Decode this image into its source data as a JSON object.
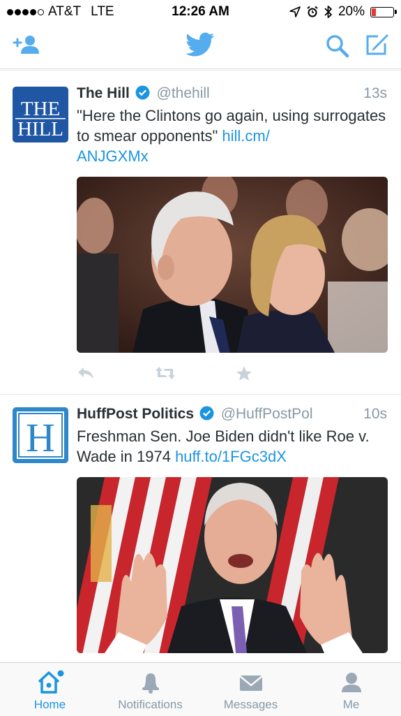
{
  "status_bar": {
    "carrier": "AT&T",
    "network": "LTE",
    "time": "12:26 AM",
    "battery_percent": "20%",
    "battery_level": 0.2,
    "signal_bars": 4
  },
  "nav": {
    "add_user_icon": "add-user-icon",
    "logo_icon": "twitter-bird-icon",
    "search_icon": "search-icon",
    "compose_icon": "compose-icon"
  },
  "colors": {
    "brand_blue": "#55acee",
    "link_blue": "#1b95e0",
    "muted_gray": "#8899a6",
    "hill_blue": "#1f57a4",
    "huffpost_blue": "#2e87c8"
  },
  "tweets": [
    {
      "name": "The Hill",
      "handle": "@thehill",
      "time": "13s",
      "verified": true,
      "avatar_text_1": "THE",
      "avatar_text_2": "HILL",
      "text": "\"Here the Clintons go again, using surrogates to smear opponents\" ",
      "link": "hill.cm/ANJGXMx",
      "link_line1": "hill.cm/",
      "link_line2": "ANJGXMx"
    },
    {
      "name": "HuffPost Politics",
      "handle": "@HuffPostPol",
      "time": "10s",
      "verified": true,
      "avatar_text": "H",
      "text": "Freshman Sen. Joe Biden didn't like Roe v. Wade in 1974 ",
      "link": "huff.to/1FGc3dX"
    }
  ],
  "tabs": [
    {
      "label": "Home",
      "icon": "home-icon",
      "active": true
    },
    {
      "label": "Notifications",
      "icon": "bell-icon",
      "active": false
    },
    {
      "label": "Messages",
      "icon": "envelope-icon",
      "active": false
    },
    {
      "label": "Me",
      "icon": "person-icon",
      "active": false
    }
  ]
}
